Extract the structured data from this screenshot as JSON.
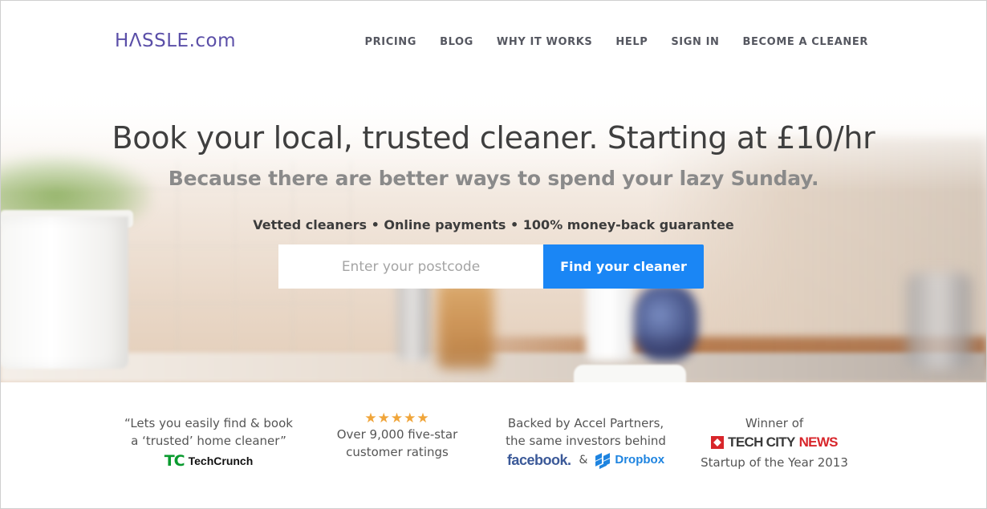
{
  "header": {
    "logo": "HΛSSLE.com",
    "nav": [
      "PRICING",
      "BLOG",
      "WHY IT WORKS",
      "HELP",
      "SIGN IN",
      "BECOME A CLEANER"
    ]
  },
  "hero": {
    "headline": "Book your local, trusted cleaner. Starting at £10/hr",
    "subhead": "Because there are better ways to spend your lazy Sunday.",
    "benefits": "Vetted cleaners • Online payments • 100% money-back guarantee",
    "search": {
      "placeholder": "Enter your postcode",
      "value": "",
      "button_label": "Find your cleaner"
    }
  },
  "press": {
    "techcrunch": {
      "quote_line1": "“Lets you easily find & book",
      "quote_line2": "a ‘trusted’ home cleaner”",
      "logo_mark": "TC",
      "logo_text": "TechCrunch"
    },
    "ratings": {
      "stars": "★★★★★",
      "line1": "Over 9,000 five-star",
      "line2": "customer ratings"
    },
    "backers": {
      "line1": "Backed by Accel Partners,",
      "line2": "the same investors behind",
      "facebook": "facebook.",
      "amp": "&",
      "dropbox": "Dropbox"
    },
    "award": {
      "line1": "Winner of",
      "logo_tech": "TECH CITY",
      "logo_news": "NEWS",
      "line2": "Startup of the Year 2013"
    }
  },
  "colors": {
    "brand": "#5b4fa8",
    "cta": "#1a86f5",
    "stars": "#f0a53a",
    "techcrunch_green": "#0a9b2f",
    "facebook_blue": "#3b5998",
    "dropbox_blue": "#1e84e0",
    "tcn_red": "#d8262b"
  }
}
